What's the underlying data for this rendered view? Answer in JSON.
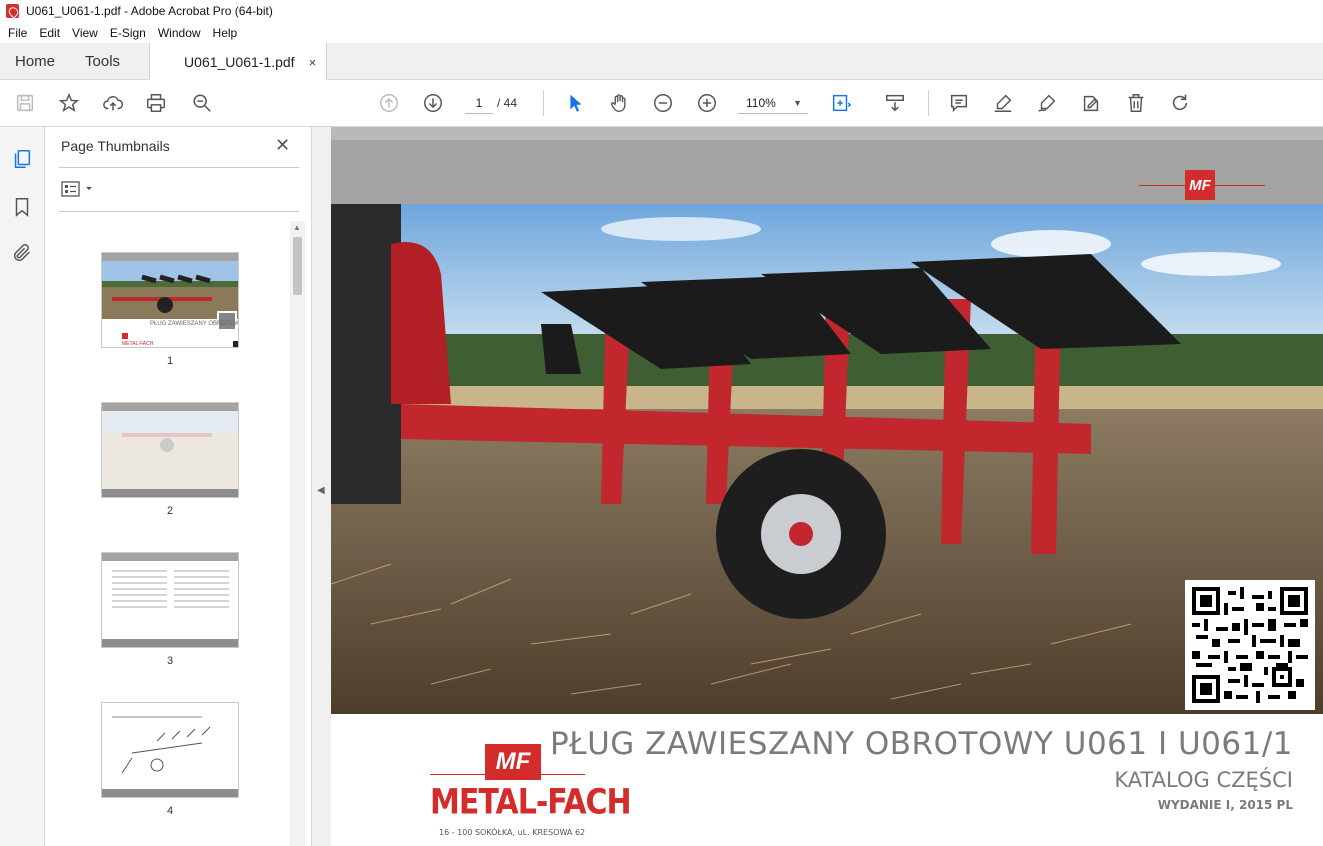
{
  "window": {
    "title": "U061_U061-1.pdf - Adobe Acrobat Pro (64-bit)"
  },
  "menu": [
    "File",
    "Edit",
    "View",
    "E-Sign",
    "Window",
    "Help"
  ],
  "tabs": {
    "home": "Home",
    "tools": "Tools",
    "document": "U061_U061-1.pdf",
    "close": "×"
  },
  "toolbar": {
    "page_current": "1",
    "page_total": "/ 44",
    "zoom": "110%",
    "icons": [
      "save-icon",
      "bookmark-star-icon",
      "upload-icon",
      "print-icon",
      "search-icon",
      "prev-page-icon",
      "next-page-icon",
      "select-cursor-icon",
      "hand-icon",
      "zoom-out-icon",
      "zoom-in-icon",
      "fit-page-icon",
      "scroll-mode-icon",
      "comment-icon",
      "highlight-icon",
      "sign-icon",
      "edit-icon",
      "delete-icon",
      "rotate-icon"
    ]
  },
  "sidebar": {
    "title": "Page Thumbnails",
    "close": "✕",
    "thumbnails": [
      {
        "label": "1"
      },
      {
        "label": "2"
      },
      {
        "label": "3"
      },
      {
        "label": "4"
      }
    ]
  },
  "page": {
    "header_logo": "MF",
    "title": "PŁUG ZAWIESZANY OBROTOWY U061 I U061/1",
    "subtitle": "KATALOG CZĘŚCI",
    "edition": "WYDANIE I, 2015 PL",
    "brand_logo": "MF",
    "brand_name": "METAL-FACH",
    "brand_address": "16 - 100 SOKÓŁKA, uL. KRESOWA 62"
  },
  "colors": {
    "brand_red": "#d42b2b",
    "header_gray": "#a3a3a3",
    "accent_blue": "#1473e6"
  }
}
